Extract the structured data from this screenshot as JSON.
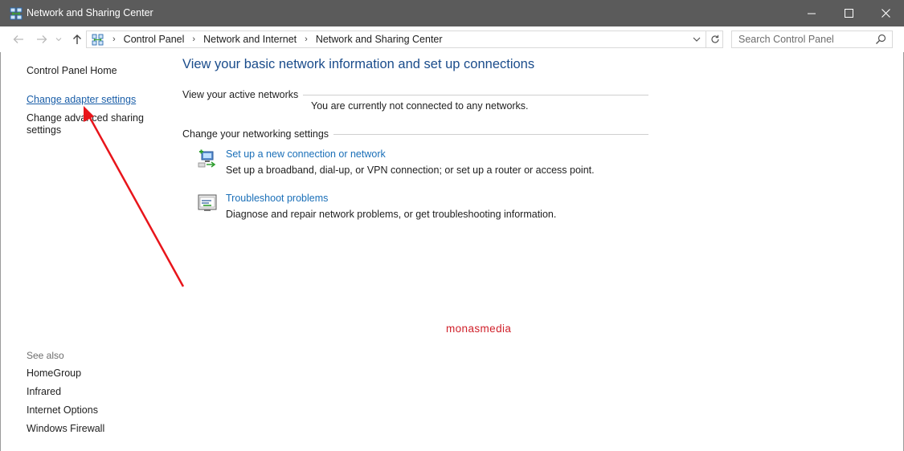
{
  "window": {
    "title": "Network and Sharing Center",
    "icon": "network-center-icon"
  },
  "address_bar": {
    "breadcrumbs": [
      "Control Panel",
      "Network and Internet",
      "Network and Sharing Center"
    ],
    "search_placeholder": "Search Control Panel"
  },
  "left_pane": {
    "home": "Control Panel Home",
    "links": [
      "Change adapter settings",
      "Change advanced sharing",
      "settings"
    ],
    "see_also_label": "See also",
    "see_also": [
      "HomeGroup",
      "Infrared",
      "Internet Options",
      "Windows Firewall"
    ]
  },
  "main": {
    "title": "View your basic network information and set up connections",
    "active_networks_label": "View your active networks",
    "no_networks_text": "You are currently not connected to any networks.",
    "change_settings_label": "Change your networking settings",
    "tasks": [
      {
        "link": "Set up a new connection or network",
        "description": "Set up a broadband, dial-up, or VPN connection; or set up a router or access point.",
        "icon": "new-connection-icon"
      },
      {
        "link": "Troubleshoot problems",
        "description": "Diagnose and repair network problems, or get troubleshooting information.",
        "icon": "troubleshoot-icon"
      }
    ]
  },
  "watermark": "monasmedia",
  "colors": {
    "titlebar": "#5b5b5b",
    "link_blue": "#1a6fb8",
    "title_blue": "#1a4c8b",
    "annotation_red": "#e8151b",
    "watermark_red": "#d0202a"
  }
}
